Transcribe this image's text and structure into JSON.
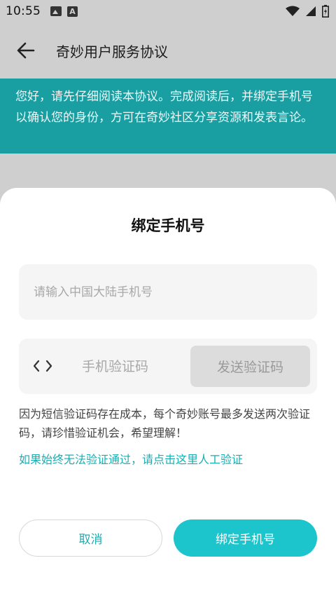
{
  "status_bar": {
    "time": "10:55",
    "icons": [
      "image-icon",
      "text-a-icon",
      "wifi-icon",
      "signal-icon",
      "battery-charging-icon"
    ]
  },
  "app_bar": {
    "back_icon": "arrow-left-icon",
    "title": "奇妙用户服务协议"
  },
  "notice": {
    "text": "您好，请先仔细阅读本协议。完成阅读后，并绑定手机号以确认您的身份，方可在奇妙社区分享资源和发表言论。",
    "background": "#199ea1"
  },
  "dialog": {
    "title": "绑定手机号",
    "phone_field": {
      "value": "",
      "placeholder": "请输入中国大陆手机号"
    },
    "code_field": {
      "icon": "code-brackets-icon",
      "value": "",
      "placeholder": "手机验证码"
    },
    "send_code_label": "发送验证码",
    "tip": "因为短信验证码存在成本，每个奇妙账号最多发送两次验证码，请珍惜验证机会，希望理解！",
    "manual_verify_link": "如果始终无法验证通过，请点击这里人工验证",
    "cancel_label": "取消",
    "bind_label": "绑定手机号",
    "accent_color": "#1cc4cc"
  }
}
